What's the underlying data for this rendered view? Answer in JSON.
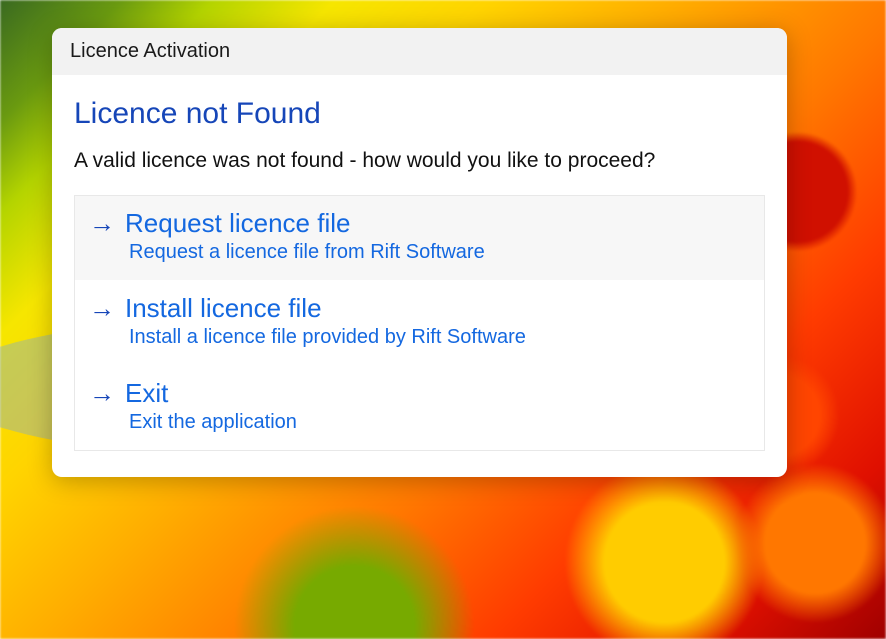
{
  "dialog": {
    "title": "Licence Activation",
    "heading": "Licence not Found",
    "description": "A valid licence was not found - how would you like to proceed?",
    "options": [
      {
        "title": "Request licence file",
        "subtitle": "Request a licence file from Rift Software"
      },
      {
        "title": "Install licence file",
        "subtitle": "Install a licence file provided by Rift Software"
      },
      {
        "title": "Exit",
        "subtitle": "Exit the application"
      }
    ]
  },
  "highlight": {
    "option_index": 1
  }
}
